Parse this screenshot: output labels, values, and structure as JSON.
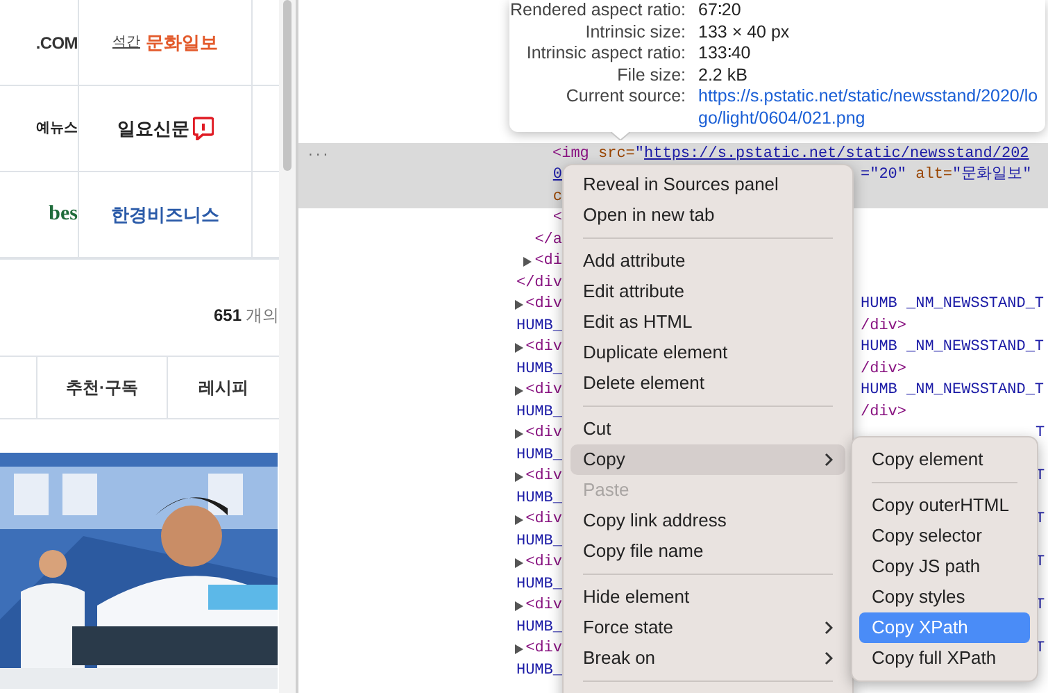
{
  "webpage": {
    "logos": [
      {
        "kind": "com",
        "text": ".COM"
      },
      {
        "kind": "munhwa",
        "prefix": "석간",
        "name": "문화일보"
      },
      {
        "kind": "cut",
        "text": "예뉴스"
      },
      {
        "kind": "ilyo",
        "name": "일요신문"
      },
      {
        "kind": "forbes",
        "text": "bes"
      },
      {
        "kind": "hankyung",
        "name": "한경비즈니스"
      }
    ],
    "count": {
      "number": "651",
      "unit": "개의"
    },
    "tabs": [
      "추천·구독",
      "레시피"
    ]
  },
  "devtools": {
    "tooltip": {
      "rows": [
        {
          "label": "Rendered aspect ratio:",
          "value": "67∶20",
          "kind": "text"
        },
        {
          "label": "Intrinsic size:",
          "value": "133 × 40 px",
          "kind": "text"
        },
        {
          "label": "Intrinsic aspect ratio:",
          "value": "133∶40",
          "kind": "text"
        },
        {
          "label": "File size:",
          "value": "2.2 kB",
          "kind": "text"
        },
        {
          "label": "Current source:",
          "value": "https://s.pstatic.net/static/newsstand/2020/logo/light/0604/021.png",
          "kind": "link"
        }
      ]
    },
    "code_rows": [
      {
        "kind": "full",
        "highlighted": true,
        "marker": "...",
        "left": [
          {
            "text": "<img",
            "color": "#881280",
            "link": false
          },
          {
            "text": " src=",
            "color": "#994500",
            "link": false
          },
          {
            "text": "\"",
            "color": "#1a1aa6",
            "link": false
          },
          {
            "text": "https://s.pstatic.net/static/newsstand/202",
            "color": "#1a1aa6",
            "link": true
          }
        ]
      },
      {
        "kind": "line",
        "highlighted": true,
        "left": [
          {
            "text": "0",
            "color": "#1a1aa6",
            "link": true
          }
        ],
        "right": [
          {
            "text": "=\"20\"",
            "color": "#1a1aa6",
            "link": false
          },
          {
            "text": " alt=",
            "color": "#994500",
            "link": false
          },
          {
            "text": "\"문화일보\"",
            "color": "#1a1aa6",
            "link": false
          }
        ]
      },
      {
        "kind": "line",
        "highlighted": true,
        "left": [
          {
            "text": "c",
            "color": "#994500",
            "link": false
          }
        ]
      },
      {
        "kind": "line",
        "highlighted": false,
        "left": [
          {
            "text": "<",
            "color": "#881280",
            "link": false
          }
        ]
      },
      {
        "kind": "line",
        "highlighted": false,
        "left": [
          {
            "text": "</a",
            "color": "#881280",
            "link": false
          }
        ]
      },
      {
        "kind": "node",
        "highlighted": false,
        "left": [
          {
            "text": "<di",
            "color": "#881280",
            "link": false
          }
        ]
      },
      {
        "kind": "line",
        "highlighted": false,
        "left": [
          {
            "text": "</div",
            "color": "#881280",
            "link": false
          }
        ]
      },
      {
        "kind": "node",
        "highlighted": false,
        "left": [
          {
            "text": "<div",
            "color": "#881280",
            "link": false
          }
        ],
        "right": [
          {
            "text": "HUMB _NM_NEWSSTAND_T",
            "color": "#1a1aa6",
            "link": false
          }
        ]
      },
      {
        "kind": "line",
        "highlighted": false,
        "left": [
          {
            "text": "HUMB_",
            "color": "#1a1aa6",
            "link": false
          }
        ],
        "right": [
          {
            "text": "/div>",
            "color": "#881280",
            "link": false
          }
        ]
      },
      {
        "kind": "node",
        "highlighted": false,
        "left": [
          {
            "text": "<div",
            "color": "#881280",
            "link": false
          }
        ],
        "right": [
          {
            "text": "HUMB _NM_NEWSSTAND_T",
            "color": "#1a1aa6",
            "link": false
          }
        ]
      },
      {
        "kind": "line",
        "highlighted": false,
        "left": [
          {
            "text": "HUMB_",
            "color": "#1a1aa6",
            "link": false
          }
        ],
        "right": [
          {
            "text": "/div>",
            "color": "#881280",
            "link": false
          }
        ]
      },
      {
        "kind": "node",
        "highlighted": false,
        "left": [
          {
            "text": "<div",
            "color": "#881280",
            "link": false
          }
        ],
        "right": [
          {
            "text": "HUMB _NM_NEWSSTAND_T",
            "color": "#1a1aa6",
            "link": false
          }
        ]
      },
      {
        "kind": "line",
        "highlighted": false,
        "left": [
          {
            "text": "HUMB_",
            "color": "#1a1aa6",
            "link": false
          }
        ],
        "right": [
          {
            "text": "/div>",
            "color": "#881280",
            "link": false
          }
        ]
      },
      {
        "kind": "node",
        "highlighted": false,
        "left": [
          {
            "text": "<div",
            "color": "#881280",
            "link": false
          }
        ],
        "far": "T"
      },
      {
        "kind": "line",
        "highlighted": false,
        "left": [
          {
            "text": "HUMB_",
            "color": "#1a1aa6",
            "link": false
          }
        ]
      },
      {
        "kind": "node",
        "highlighted": false,
        "left": [
          {
            "text": "<div",
            "color": "#881280",
            "link": false
          }
        ],
        "far": "T"
      },
      {
        "kind": "line",
        "highlighted": false,
        "left": [
          {
            "text": "HUMB_",
            "color": "#1a1aa6",
            "link": false
          }
        ]
      },
      {
        "kind": "node",
        "highlighted": false,
        "left": [
          {
            "text": "<div",
            "color": "#881280",
            "link": false
          }
        ],
        "far": "T"
      },
      {
        "kind": "line",
        "highlighted": false,
        "left": [
          {
            "text": "HUMB_",
            "color": "#1a1aa6",
            "link": false
          }
        ]
      },
      {
        "kind": "node",
        "highlighted": false,
        "left": [
          {
            "text": "<div",
            "color": "#881280",
            "link": false
          }
        ],
        "far": "T"
      },
      {
        "kind": "line",
        "highlighted": false,
        "left": [
          {
            "text": "HUMB_",
            "color": "#1a1aa6",
            "link": false
          }
        ]
      },
      {
        "kind": "node",
        "highlighted": false,
        "left": [
          {
            "text": "<div",
            "color": "#881280",
            "link": false
          }
        ],
        "far": "T"
      },
      {
        "kind": "line",
        "highlighted": false,
        "left": [
          {
            "text": "HUMB_",
            "color": "#1a1aa6",
            "link": false
          }
        ]
      },
      {
        "kind": "node",
        "highlighted": false,
        "left": [
          {
            "text": "<div",
            "color": "#881280",
            "link": false
          }
        ],
        "far": "T"
      },
      {
        "kind": "line",
        "highlighted": false,
        "left": [
          {
            "text": "HUMB_",
            "color": "#1a1aa6",
            "link": false
          }
        ]
      }
    ],
    "context_menu": {
      "items": [
        {
          "kind": "item",
          "label": "Reveal in Sources panel",
          "selected": false,
          "disabled": false,
          "submenu": false
        },
        {
          "kind": "item",
          "label": "Open in new tab",
          "selected": false,
          "disabled": false,
          "submenu": false
        },
        {
          "kind": "separator"
        },
        {
          "kind": "item",
          "label": "Add attribute",
          "selected": false,
          "disabled": false,
          "submenu": false
        },
        {
          "kind": "item",
          "label": "Edit attribute",
          "selected": false,
          "disabled": false,
          "submenu": false
        },
        {
          "kind": "item",
          "label": "Edit as HTML",
          "selected": false,
          "disabled": false,
          "submenu": false
        },
        {
          "kind": "item",
          "label": "Duplicate element",
          "selected": false,
          "disabled": false,
          "submenu": false
        },
        {
          "kind": "item",
          "label": "Delete element",
          "selected": false,
          "disabled": false,
          "submenu": false
        },
        {
          "kind": "separator"
        },
        {
          "kind": "item",
          "label": "Cut",
          "selected": false,
          "disabled": false,
          "submenu": false
        },
        {
          "kind": "item",
          "label": "Copy",
          "selected": true,
          "disabled": false,
          "submenu": true
        },
        {
          "kind": "item",
          "label": "Paste",
          "selected": false,
          "disabled": true,
          "submenu": false
        },
        {
          "kind": "item",
          "label": "Copy link address",
          "selected": false,
          "disabled": false,
          "submenu": false
        },
        {
          "kind": "item",
          "label": "Copy file name",
          "selected": false,
          "disabled": false,
          "submenu": false
        },
        {
          "kind": "separator"
        },
        {
          "kind": "item",
          "label": "Hide element",
          "selected": false,
          "disabled": false,
          "submenu": false
        },
        {
          "kind": "item",
          "label": "Force state",
          "selected": false,
          "disabled": false,
          "submenu": true
        },
        {
          "kind": "item",
          "label": "Break on",
          "selected": false,
          "disabled": false,
          "submenu": true
        },
        {
          "kind": "separator"
        }
      ]
    },
    "submenu": {
      "items": [
        {
          "kind": "item",
          "label": "Copy element",
          "selected": false
        },
        {
          "kind": "separator"
        },
        {
          "kind": "item",
          "label": "Copy outerHTML",
          "selected": false
        },
        {
          "kind": "item",
          "label": "Copy selector",
          "selected": false
        },
        {
          "kind": "item",
          "label": "Copy JS path",
          "selected": false
        },
        {
          "kind": "item",
          "label": "Copy styles",
          "selected": false
        },
        {
          "kind": "item",
          "label": "Copy XPath",
          "selected": true
        },
        {
          "kind": "item",
          "label": "Copy full XPath",
          "selected": false
        }
      ]
    }
  }
}
